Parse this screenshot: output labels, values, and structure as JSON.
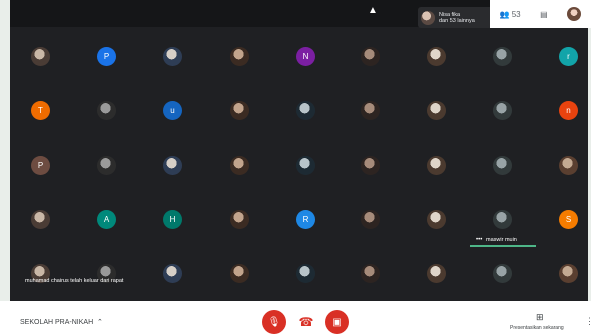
{
  "header": {
    "notification": {
      "line1": "Nisa fika",
      "line2": "dan 53 lainnya"
    },
    "participant_count": "53",
    "chat_icon": "chat-icon"
  },
  "grid": {
    "rows": [
      [
        "img",
        "P",
        "img",
        "img",
        "N",
        "img",
        "img",
        "img",
        "r"
      ],
      [
        "T",
        "img",
        "u",
        "img",
        "img",
        "img",
        "img",
        "img",
        "n"
      ],
      [
        "P",
        "img",
        "img",
        "img",
        "img",
        "img",
        "img",
        "img",
        "img"
      ],
      [
        "img",
        "A",
        "H",
        "img",
        "R",
        "img",
        "img",
        "img",
        "S"
      ],
      [
        "img",
        "img",
        "img",
        "img",
        "img",
        "img",
        "img",
        "img",
        "img"
      ]
    ],
    "letter_colors": {
      "P1": "#1a73e8",
      "N": "#7b1fa2",
      "r": "#12a4a9",
      "T": "#ef6c00",
      "u": "#1565c0",
      "n": "#e8430f",
      "P3": "#6d4c41",
      "A": "#00897b",
      "H": "#00796b",
      "R": "#1e88e5",
      "S": "#f57c00"
    },
    "speaker_name": "maswir muin"
  },
  "toast": "muhamad chairus telah keluar dari rapat",
  "bottom": {
    "meeting_name": "SEKOLAH PRA-NIKAH",
    "present_label": "Presentasikan sekarang"
  }
}
